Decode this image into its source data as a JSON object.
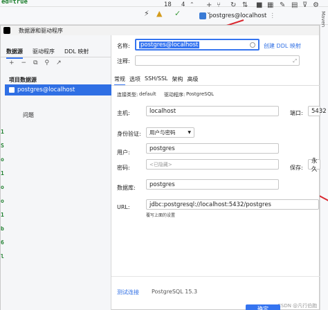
{
  "ide": {
    "warnings": "18",
    "checks": "4",
    "tab_title": "postgres@localhost",
    "code_fragment": "ed=true",
    "code_lines": [
      "1",
      "S",
      "o",
      "1",
      "o",
      "o",
      "1",
      "b",
      "6",
      "l"
    ],
    "right_edge_text": "Maven"
  },
  "dialog": {
    "title": "数据源和驱动程序",
    "left": {
      "tabs": [
        "数据源",
        "驱动程序",
        "DDL 映射"
      ],
      "toolbar_icons": [
        "plus-icon",
        "minus-icon",
        "copy-icon",
        "wrench-icon",
        "export-icon"
      ],
      "section_label": "项目数据源",
      "item": "postgres@localhost",
      "problems": "问题"
    },
    "right": {
      "name_label": "名称:",
      "name_value": "postgres@localhost",
      "create_ddl_link": "创建 DDL 映射",
      "comment_label": "注释:",
      "comment_value": "",
      "tabs": [
        "常规",
        "选项",
        "SSH/SSL",
        "架构",
        "高级"
      ],
      "connection_type_label": "连接类型:",
      "connection_type_value": "default",
      "driver_label": "驱动程序:",
      "driver_value": "PostgreSQL",
      "host_label": "主机:",
      "host_value": "localhost",
      "port_label": "端口:",
      "port_value": "5432",
      "auth_label": "身份验证:",
      "auth_value": "用户与密码",
      "user_label": "用户:",
      "user_value": "postgres",
      "password_label": "密码:",
      "password_placeholder": "<已隐藏>",
      "save_label": "保存:",
      "save_value": "永久",
      "database_label": "数据库:",
      "database_value": "postgres",
      "url_label": "URL:",
      "url_value": "jdbc:postgresql://localhost:5432/postgres",
      "url_hint": "覆写上面的设置",
      "test_connection": "测试连接",
      "version": "PostgreSQL 15.3",
      "ok_button": "确定",
      "watermark": "CSDN @凡行伯跑"
    }
  }
}
